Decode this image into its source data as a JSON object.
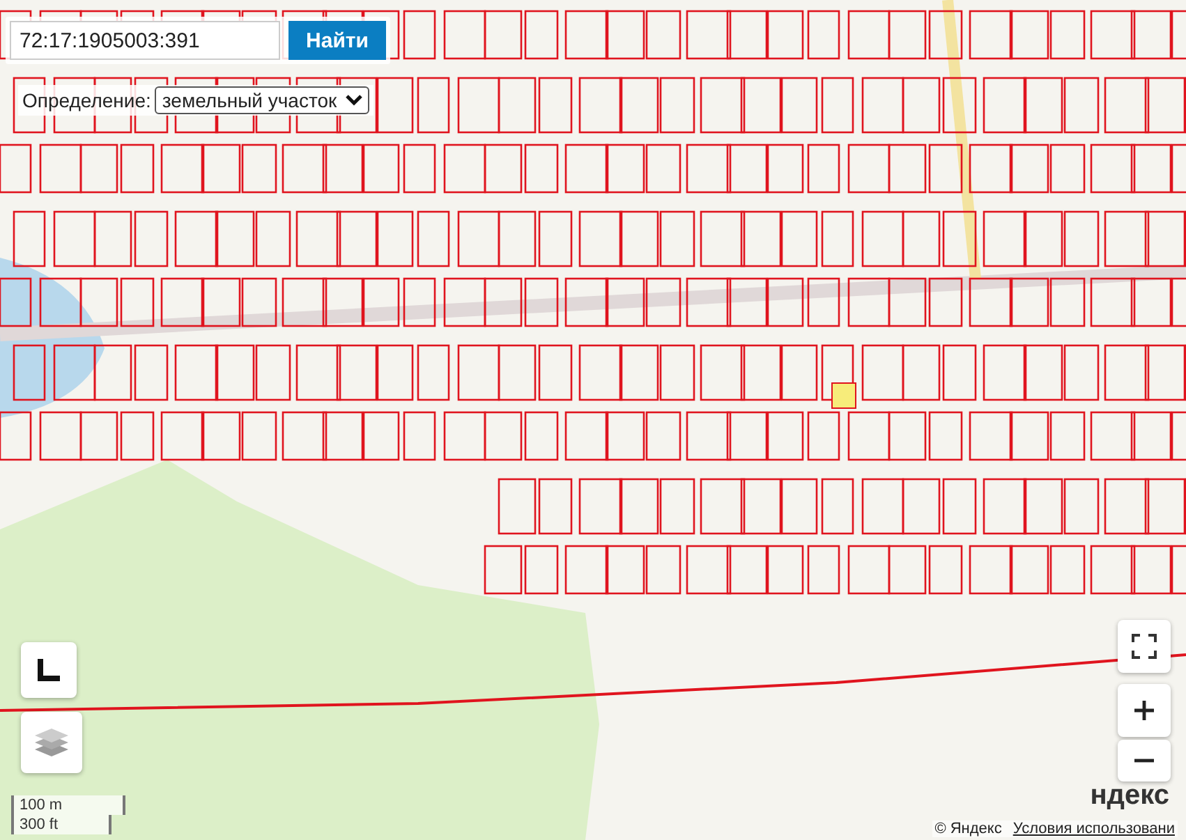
{
  "search": {
    "value": "72:17:1905003:391",
    "button": "Найти"
  },
  "definition": {
    "label": "Определение:",
    "value": "земельный участок"
  },
  "scale": {
    "metric": "100 m",
    "imperial": "300 ft"
  },
  "logo": "ндекс",
  "copyright": "© Яндекс",
  "terms_link": "Условия использовани"
}
